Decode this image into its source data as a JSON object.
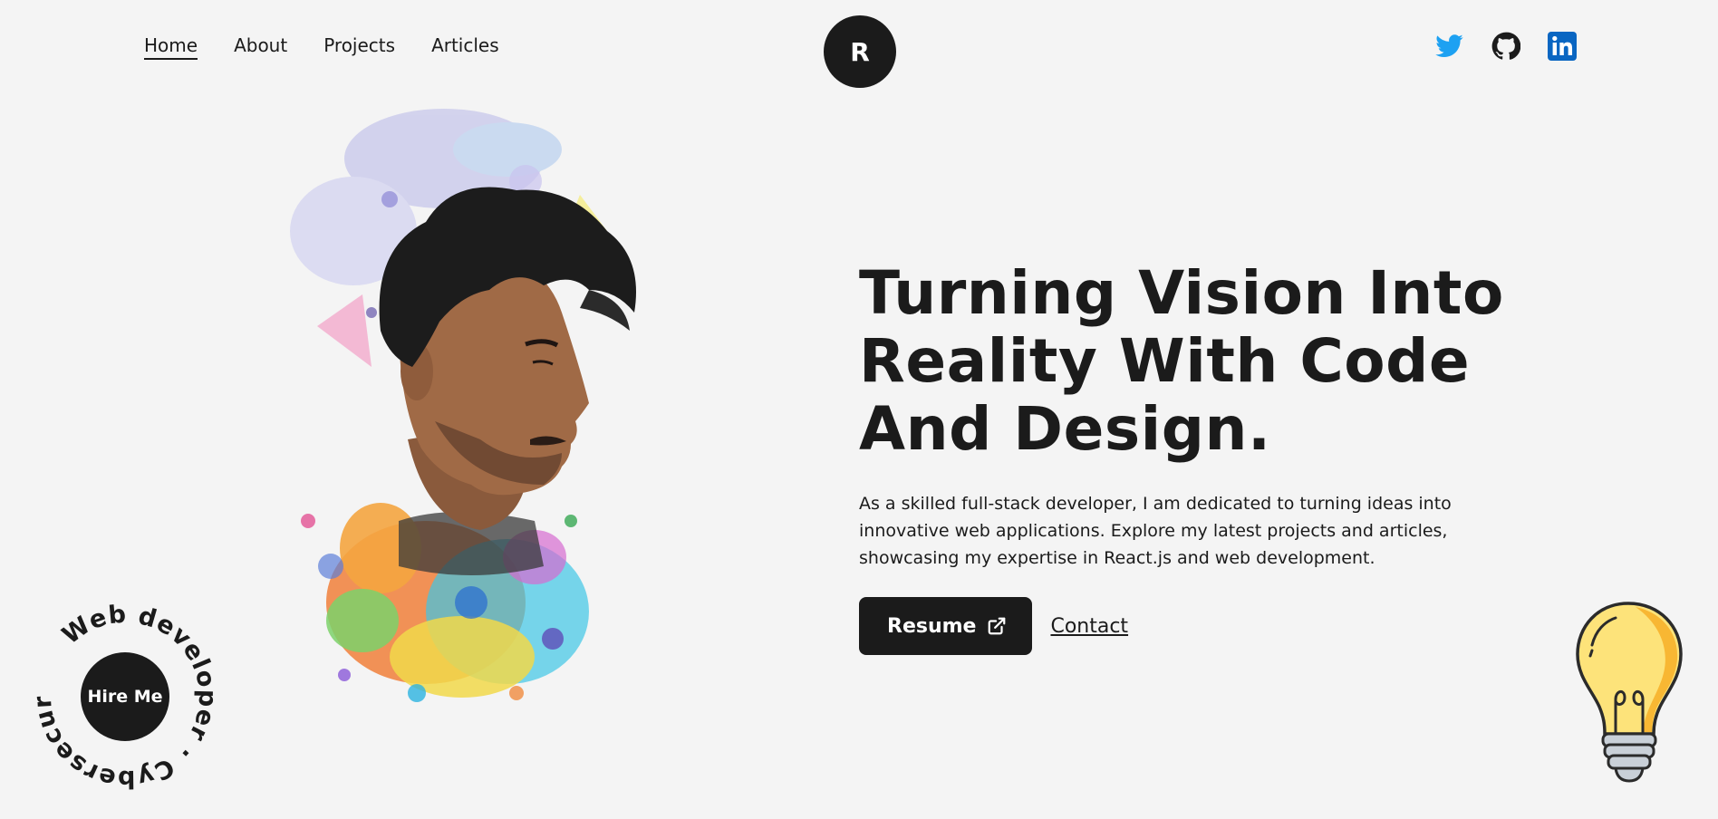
{
  "nav": {
    "items": [
      {
        "label": "Home",
        "active": true
      },
      {
        "label": "About",
        "active": false
      },
      {
        "label": "Projects",
        "active": false
      },
      {
        "label": "Articles",
        "active": false
      }
    ]
  },
  "logo": {
    "initial": "R"
  },
  "socials": [
    {
      "icon": "twitter-icon",
      "color": "#1DA1F2"
    },
    {
      "icon": "github-icon",
      "color": "#1b1b1b"
    },
    {
      "icon": "linkedin-icon",
      "color": "#0A66C2"
    }
  ],
  "hero": {
    "headline_lines": [
      "Turning Vision Into",
      "Reality With Code",
      "And Design."
    ],
    "intro_lines": [
      "As a skilled full-stack developer, I am dedicated to turning ideas into",
      "innovative web applications. Explore my latest projects and articles,",
      "showcasing my expertise in React.js and web development."
    ],
    "resume_label": "Resume",
    "contact_label": "Contact"
  },
  "hire": {
    "button_label": "Hire Me",
    "ring_text": "Web developer · Cybersecurity · "
  },
  "colors": {
    "background": "#f4f4f4",
    "dark": "#1b1b1b",
    "bulb_yellow": "#fde37a",
    "bulb_orange": "#f8b733"
  }
}
